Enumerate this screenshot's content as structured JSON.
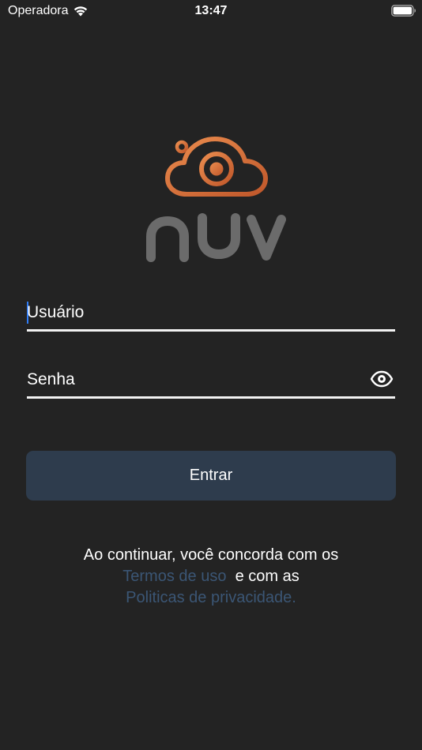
{
  "status_bar": {
    "carrier": "Operadora",
    "time": "13:47",
    "icons": [
      "wifi-icon",
      "battery-icon"
    ]
  },
  "logo": {
    "icon": "cloud-camera-logo-icon",
    "wordmark": "nuv",
    "gradient_colors": [
      "#e8874a",
      "#c0582b"
    ],
    "wordmark_color": "#6b6b6b"
  },
  "form": {
    "username_placeholder": "Usuário",
    "password_placeholder": "Senha",
    "password_toggle_icon": "eye-icon",
    "submit_label": "Entrar"
  },
  "terms": {
    "line1": "Ao continuar, você concorda com os",
    "terms_link": "Termos de uso",
    "line2": "e com as",
    "privacy_link": "Politicas de privacidade."
  },
  "colors": {
    "background": "#232323",
    "button": "#2e3c4d",
    "link": "#3b5675",
    "caret": "#2f7cf6"
  }
}
